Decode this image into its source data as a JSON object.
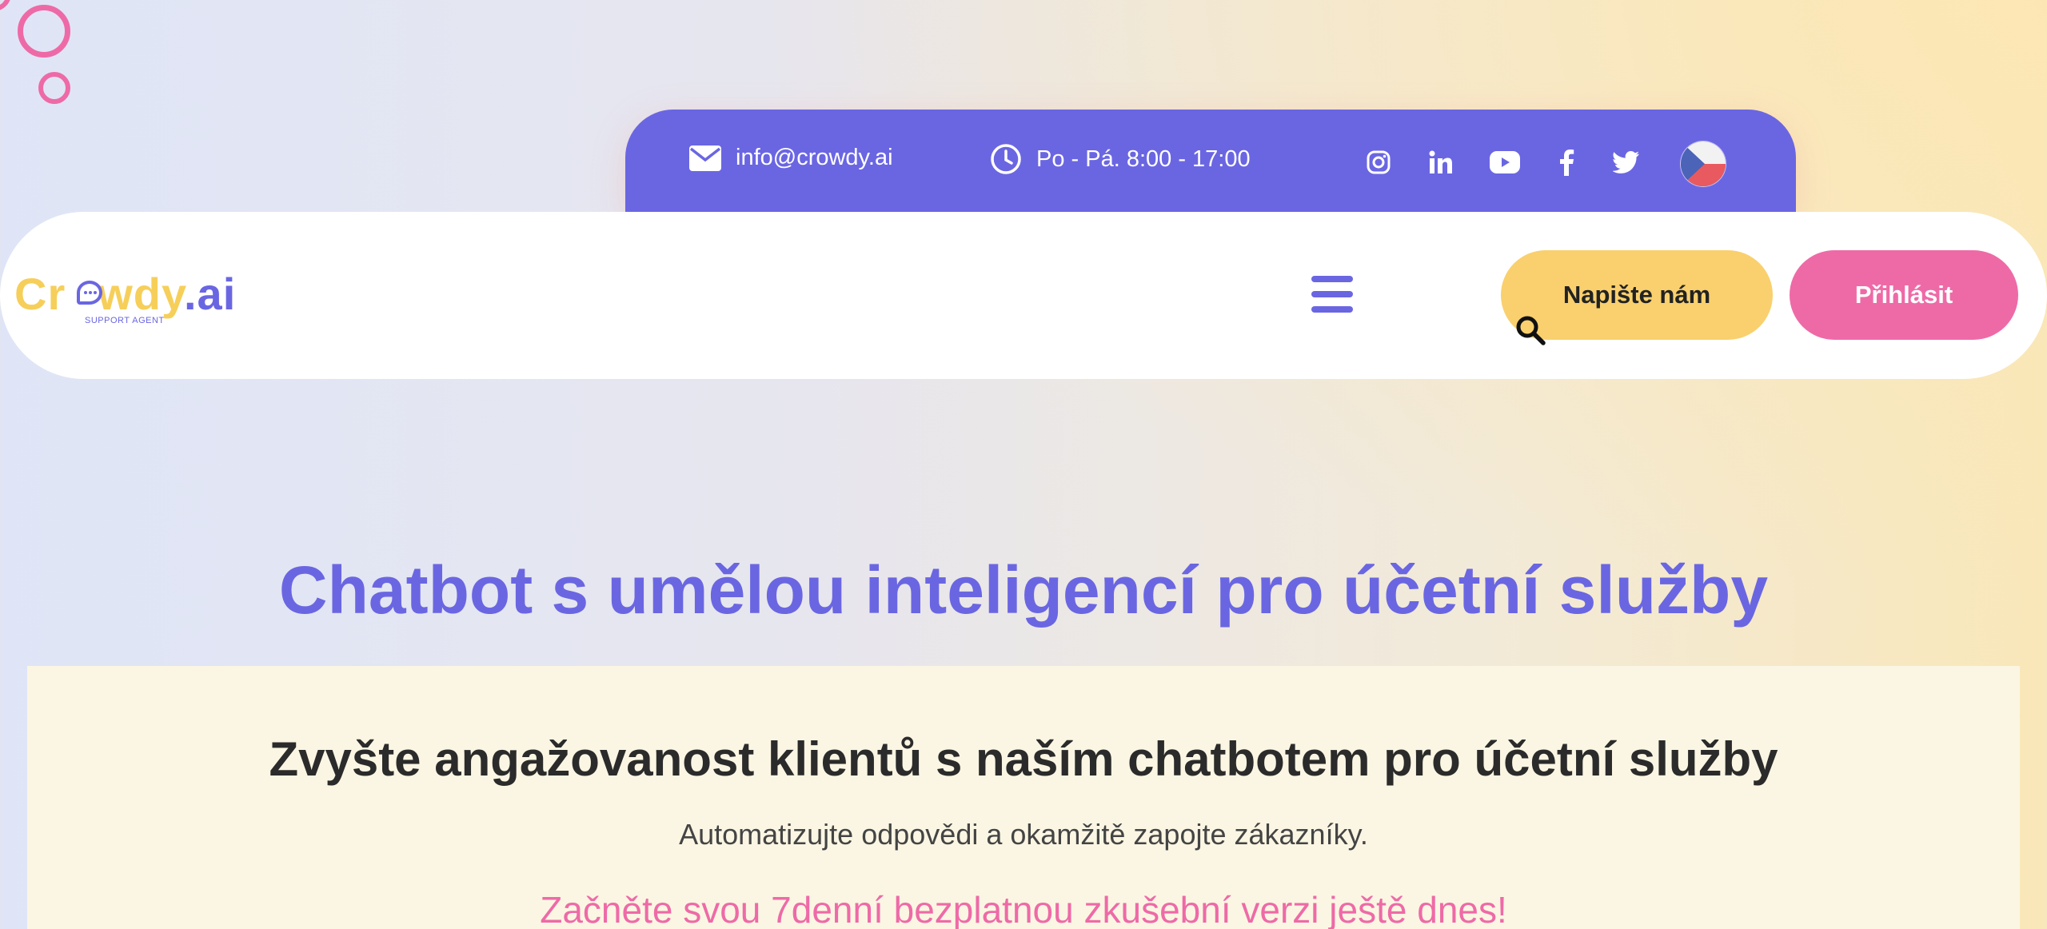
{
  "topbar": {
    "email": "info@crowdy.ai",
    "hours": "Po - Pá. 8:00 - 17:00",
    "social_icons": [
      "instagram-icon",
      "linkedin-icon",
      "youtube-icon",
      "facebook-icon",
      "twitter-icon"
    ],
    "language_flag": "czech-flag-icon"
  },
  "nav": {
    "logo_text_a": "Cr",
    "logo_text_b": "wdy",
    "logo_text_c": ".ai",
    "logo_sub": "SUPPORT AGENT",
    "write_button": "Napište nám",
    "login_button": "Přihlásit"
  },
  "hero": {
    "title": "Chatbot s umělou inteligencí pro účetní služby",
    "panel_title": "Zvyšte angažovanost klientů s naším chatbotem pro účetní služby",
    "panel_subtitle": "Automatizujte odpovědi a okamžitě zapojte zákazníky.",
    "panel_cta": "Začněte svou 7denní bezplatnou zkušební verzi ještě dnes!"
  },
  "colors": {
    "primary": "#6a66e2",
    "accent_pink": "#ee6aa7",
    "accent_yellow": "#f9d06d",
    "panel_bg": "#fbf6e3"
  }
}
